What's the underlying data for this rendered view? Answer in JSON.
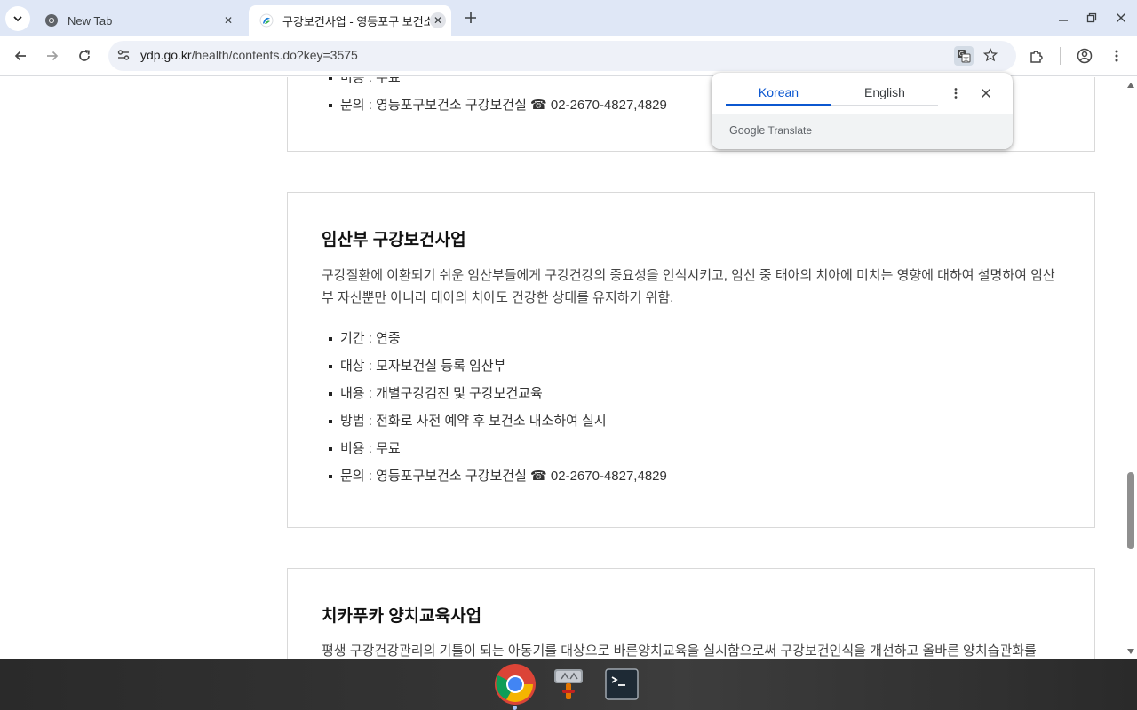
{
  "browser": {
    "tabs": [
      {
        "title": "New Tab",
        "active": false
      },
      {
        "title": "구강보건사업 - 영등포구 보건소",
        "active": true
      }
    ],
    "url": {
      "domain": "ydp.go.kr",
      "path": "/health/contents.do?key=3575"
    }
  },
  "translate_popup": {
    "source_lang": "Korean",
    "target_lang": "English",
    "brand_google": "Google",
    "brand_translate": "Translate"
  },
  "page": {
    "prev_card": {
      "cut_label": "비용 : 무료",
      "inquiry": "문의 : 영등포구보건소 구강보건실 ☎ 02-2670-4827,4829"
    },
    "main_card": {
      "title": "임산부 구강보건사업",
      "description": "구강질환에 이환되기 쉬운 임산부들에게 구강건강의 중요성을 인식시키고, 임신 중 태아의 치아에 미치는 영향에 대하여 설명하여 임산부 자신뿐만 아니라 태아의 치아도 건강한 상태를 유지하기 위함.",
      "items": [
        "기간 : 연중",
        "대상 : 모자보건실 등록 임산부",
        "내용 : 개별구강검진 및 구강보건교육",
        "방법 : 전화로 사전 예약 후 보건소 내소하여 실시",
        "비용 : 무료",
        "문의 : 영등포구보건소 구강보건실 ☎ 02-2670-4827,4829"
      ]
    },
    "next_card": {
      "title": "치카푸카 양치교육사업",
      "description": "평생 구강건강관리의 기틀이 되는 아동기를 대상으로 바른양치교육을 실시함으로써 구강보건인식을 개선하고 올바른 양치습관화를"
    }
  },
  "colors": {
    "tab_strip": "#dfe7f6",
    "accent": "#0b57d0",
    "card_border": "#d9d9d9"
  }
}
